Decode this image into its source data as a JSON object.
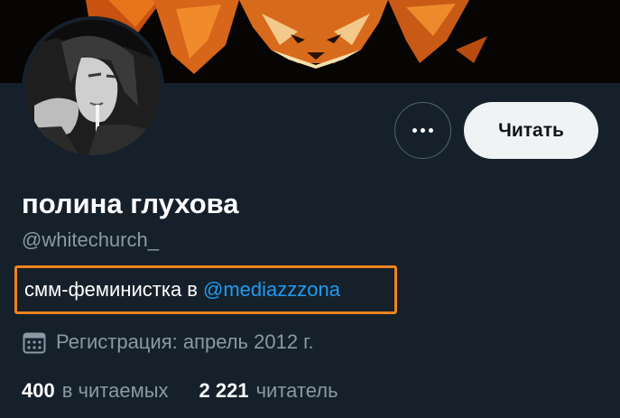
{
  "profile": {
    "display_name": "полина глухова",
    "handle": "@whitechurch_",
    "bio_text": "смм-феминистка в",
    "bio_mention": "@mediazzzona",
    "joined": "Регистрация: апрель 2012 г."
  },
  "actions": {
    "more_icon": "more-horizontal-icon",
    "follow_label": "Читать"
  },
  "stats": {
    "following_count": "400",
    "following_label": "в читаемых",
    "followers_count": "2 221",
    "followers_label": "читатель"
  },
  "colors": {
    "background": "#15202b",
    "secondary_text": "#8b98a5",
    "link": "#1d9bf0",
    "highlight_border": "#f0821e",
    "follow_button_bg": "#eff3f4"
  },
  "icons": {
    "calendar": "calendar-icon"
  }
}
